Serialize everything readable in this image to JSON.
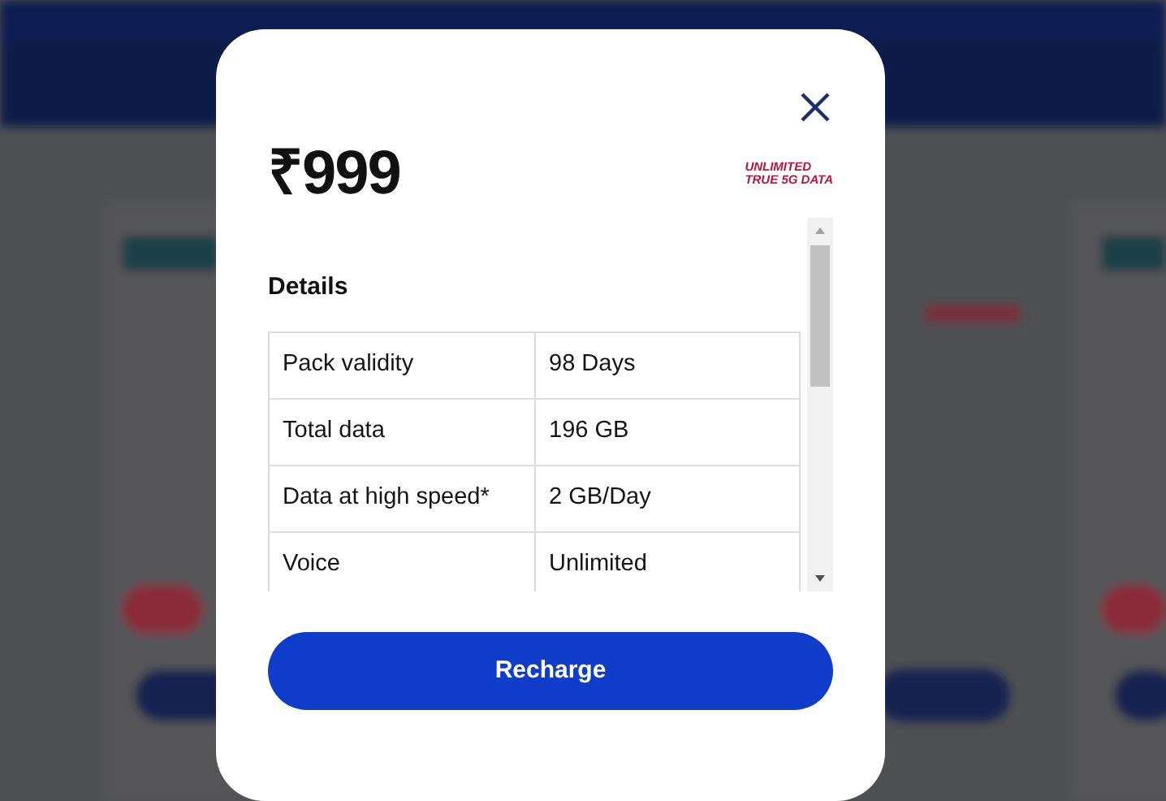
{
  "modal": {
    "price": "₹999",
    "badge_lines": [
      "UNLIMITED",
      "TRUE 5G DATA"
    ],
    "section_title": "Details",
    "details": [
      {
        "label": "Pack validity",
        "value": "98 Days"
      },
      {
        "label": "Total data",
        "value": "196 GB"
      },
      {
        "label": "Data at high speed*",
        "value": "2 GB/Day"
      },
      {
        "label": "Voice",
        "value": "Unlimited"
      }
    ],
    "button": "Recharge"
  }
}
